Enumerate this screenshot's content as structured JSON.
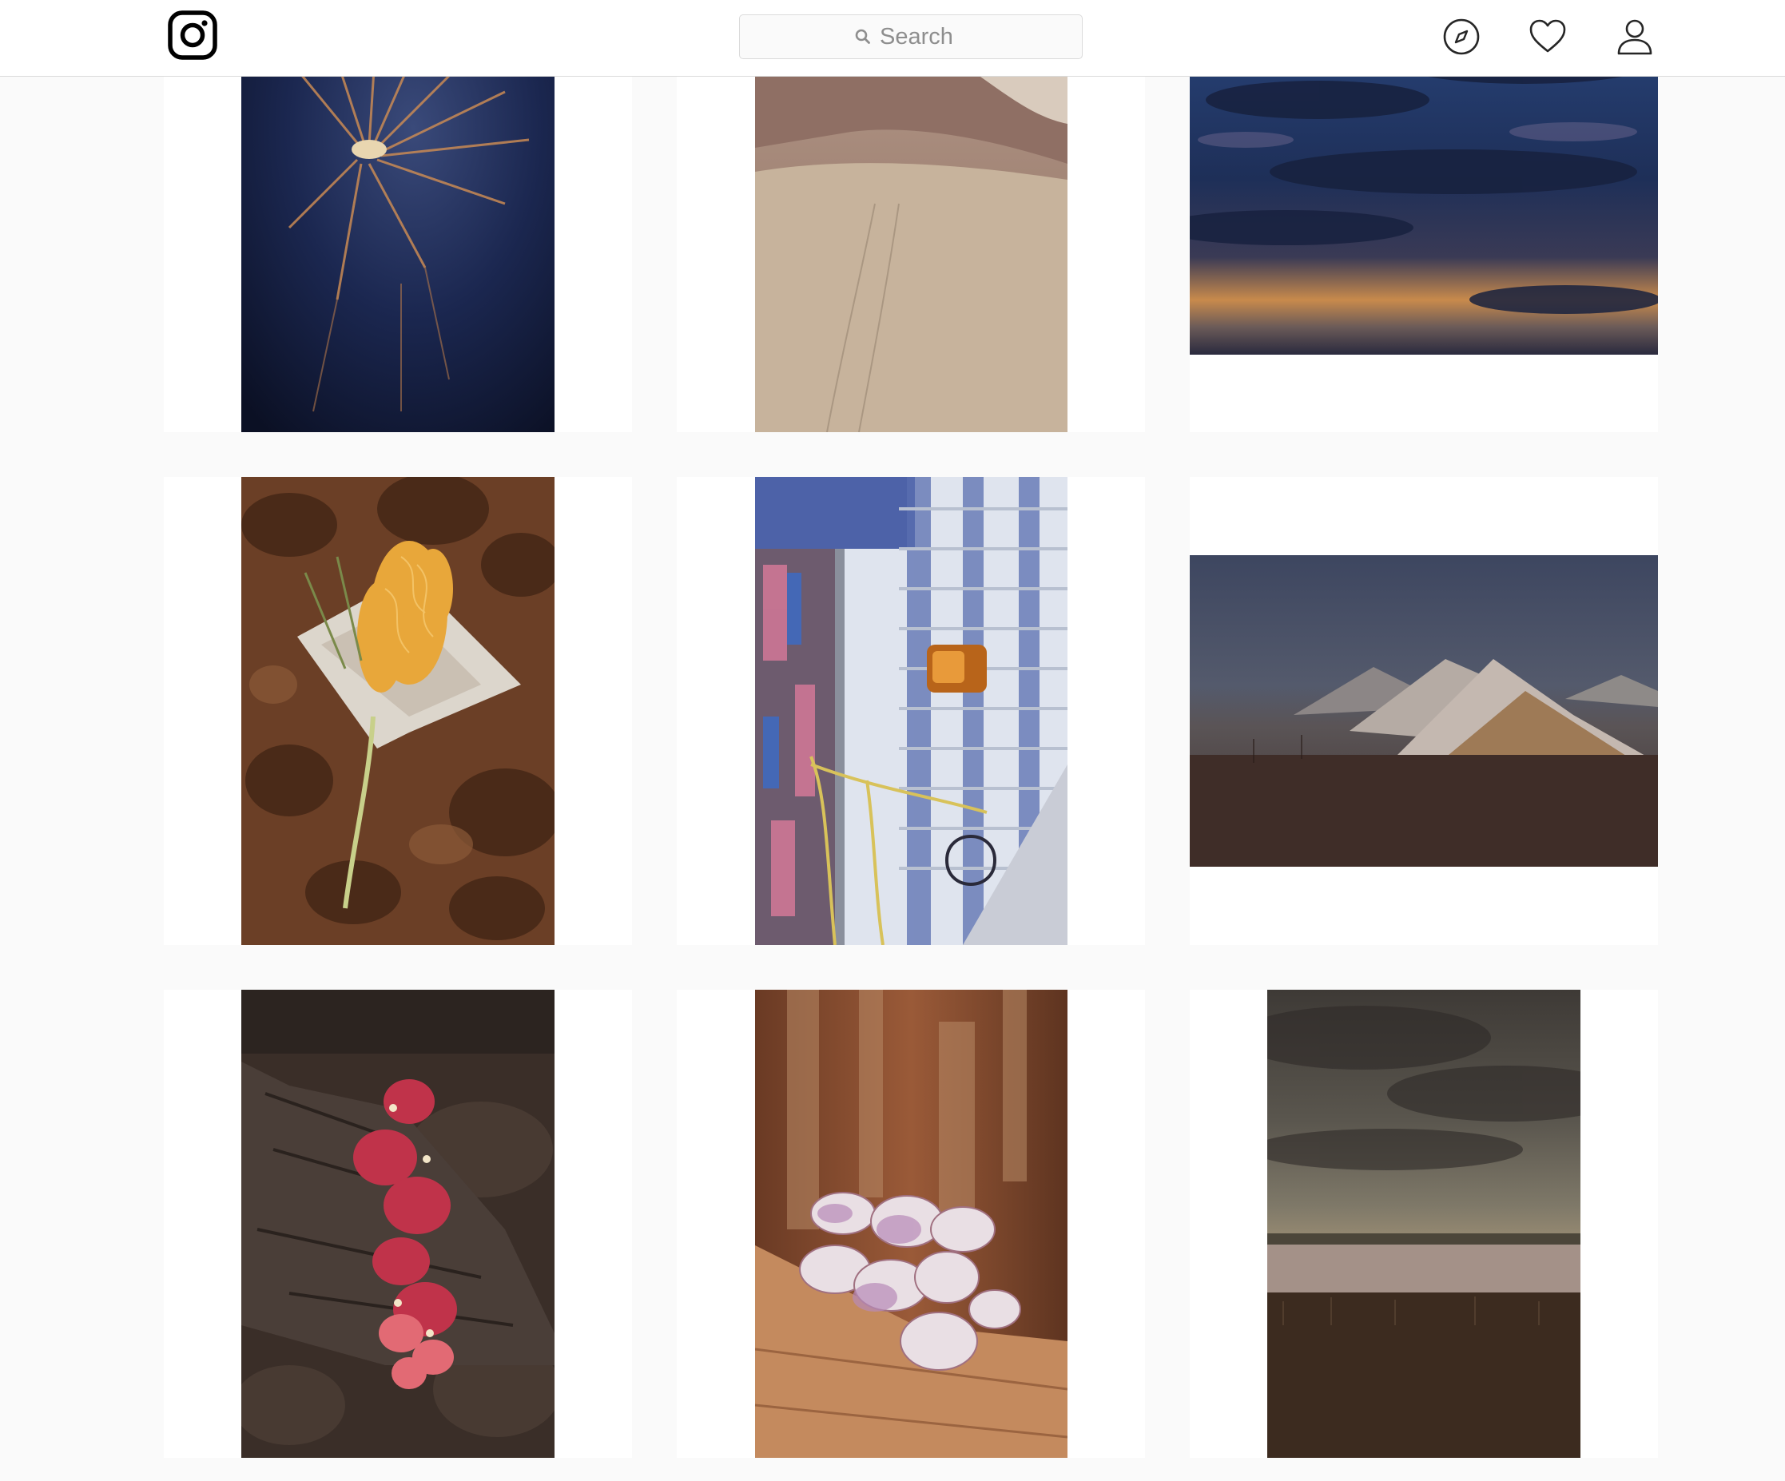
{
  "header": {
    "logo_icon": "instagram-glyph-icon",
    "search": {
      "placeholder": "Search",
      "value": "",
      "icon": "search-icon"
    },
    "nav_icons": [
      "compass-icon",
      "heart-icon",
      "user-icon"
    ]
  },
  "colors": {
    "topbar_bg": "#ffffff",
    "page_bg": "#fafafa",
    "border": "#dbdbdb",
    "icon": "#262626",
    "placeholder": "#8e8e8e"
  },
  "grid": {
    "columns": 3,
    "rows": 3,
    "posts": [
      {
        "subject": "night-water-palm-frond",
        "orientation": "portrait"
      },
      {
        "subject": "desert-hills-track",
        "orientation": "portrait"
      },
      {
        "subject": "sunset-dark-clouds",
        "orientation": "landscape"
      },
      {
        "subject": "grevillea-flower-on-foil",
        "orientation": "portrait"
      },
      {
        "subject": "caravan-side-with-rope",
        "orientation": "portrait"
      },
      {
        "subject": "opal-mine-mullock-heaps",
        "orientation": "landscape"
      },
      {
        "subject": "bougainvillea-on-stump",
        "orientation": "portrait"
      },
      {
        "subject": "shells-in-tree-trunk",
        "orientation": "portrait"
      },
      {
        "subject": "salt-lake-stormy-sky",
        "orientation": "portrait"
      }
    ]
  }
}
